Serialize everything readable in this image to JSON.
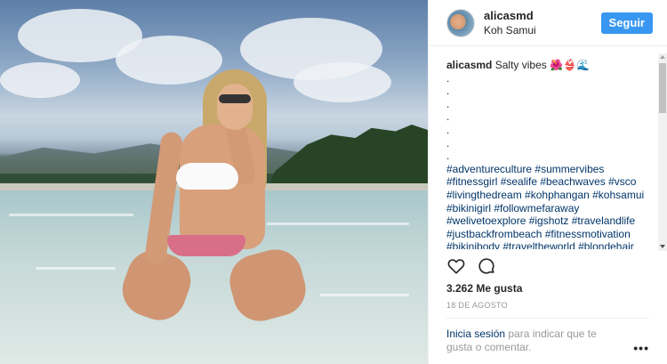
{
  "post": {
    "username": "alicasmd",
    "location": "Koh Samui",
    "follow_label": "Seguir",
    "caption_text": "Salty vibes",
    "caption_emoji": "🌺👙🌊",
    "caption_dots": [
      ".",
      ".",
      ".",
      ".",
      ".",
      ".",
      "."
    ],
    "hashtag_lines": [
      "#adventureculture #summervibes",
      "#fitnessgirl #sealife #beachwaves #vsco",
      "#livingthedream #kohphangan #kohsamui",
      "#bikinigirl #followmefaraway",
      "#welivetoexplore #igshotz #travelandlife",
      "#justbackfrombeach #fitnessmotivation",
      "#bikinibody #traveltheworld #blondehair"
    ],
    "likes": "3.262 Me gusta",
    "date": "18 DE AGOSTO",
    "login_link": "Inicia sesión",
    "login_text": " para indicar que te gusta o comentar.",
    "more_label": "•••"
  },
  "icons": {
    "like": "heart-icon",
    "comment": "comment-icon",
    "more": "more-options-icon"
  },
  "colors": {
    "follow_button": "#3897f0",
    "hashtag": "#003569",
    "muted": "#999999"
  }
}
